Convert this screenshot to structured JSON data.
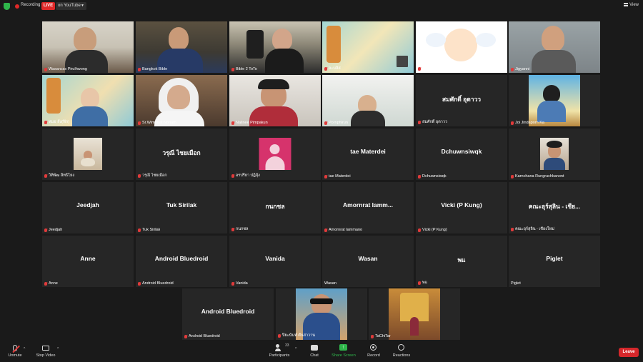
{
  "topbar": {
    "recording_label": "Recording",
    "live_badge": "LIVE",
    "stream_label": "on YouTube",
    "view_label": "View"
  },
  "participants": [
    {
      "name": "Wasancss Pirulhwong",
      "video": true
    },
    {
      "name": "Bangkok Bible",
      "video": true,
      "active": true
    },
    {
      "name": "Bible 2 ToTo",
      "video": true
    },
    {
      "name": "ละมลิส",
      "video": true
    },
    {
      "name": "แม่นางสงค์ สมาชิก",
      "video": true
    },
    {
      "name": "Jigyanni",
      "video": true
    },
    {
      "name": "หมอ ลั้ง(ฟิก)",
      "video": true
    },
    {
      "name": "Sr.Wimolrat Nonam",
      "video": true
    },
    {
      "name": "Nalinee Pimpakun",
      "video": true
    },
    {
      "name": "Pornphirun",
      "video": true
    },
    {
      "name": "สมศักดิ์ อุดาวว",
      "display": "สมศักดิ์ อุดาวว",
      "video": false
    },
    {
      "name": "Joi Jindaporn Ka",
      "video": true
    },
    {
      "name": "วิทิพัฒ สิทธิโยง",
      "video": true
    },
    {
      "name": "วรุณี ไชยเมือก",
      "display": "วรุณี ไชยเมือก",
      "video": false
    },
    {
      "name": "อรปรียา ปฎิสุ้ง",
      "video": false,
      "avatar": true
    },
    {
      "name": "tae Materdei",
      "display": "tae Materdei",
      "video": false
    },
    {
      "name": "Dchuwnsiwqk",
      "display": "Dchuwnsiwqk",
      "video": false
    },
    {
      "name": "Karnchana Rungruchkanont",
      "video": true
    },
    {
      "name": "Jeedjah",
      "display": "Jeedjah",
      "video": false
    },
    {
      "name": "Tuk Sirilak",
      "display": "Tuk Sirilak",
      "video": false
    },
    {
      "name": "กนกชล",
      "display": "กนกชล",
      "video": false
    },
    {
      "name": "Amornrat Iammano",
      "display": "Amornrat Iamm...",
      "video": false
    },
    {
      "name": "Vicki (P Kung)",
      "display": "Vicki (P Kung)",
      "video": false
    },
    {
      "name": "คณะอุร์สุลิน - เชียงใหม่",
      "display": "คณะอุร์สุลิน - เชีย...",
      "video": false
    },
    {
      "name": "Anne",
      "display": "Anne",
      "video": false
    },
    {
      "name": "Android Bluedroid",
      "display": "Android Bluedroid",
      "video": false
    },
    {
      "name": "Vanida",
      "display": "Vanida",
      "video": false
    },
    {
      "name": "Wasan",
      "display": "Wasan",
      "video": false
    },
    {
      "name": "พแ",
      "display": "พแ",
      "video": false
    },
    {
      "name": "Piglet",
      "display": "Piglet",
      "video": false
    },
    {
      "name": "Android Bluedroid",
      "display": "Android Bluedroid",
      "video": false
    },
    {
      "name": "ปิยะนันท์ ศันสาวาน",
      "video": true
    },
    {
      "name": "TaChiTar",
      "video": true
    }
  ],
  "toolbar": {
    "unmute": "Unmute",
    "stop_video": "Stop Video",
    "participants": "Participants",
    "participants_count": "33",
    "chat": "Chat",
    "share_screen": "Share Screen",
    "record": "Record",
    "reactions": "Reactions",
    "leave": "Leave"
  }
}
